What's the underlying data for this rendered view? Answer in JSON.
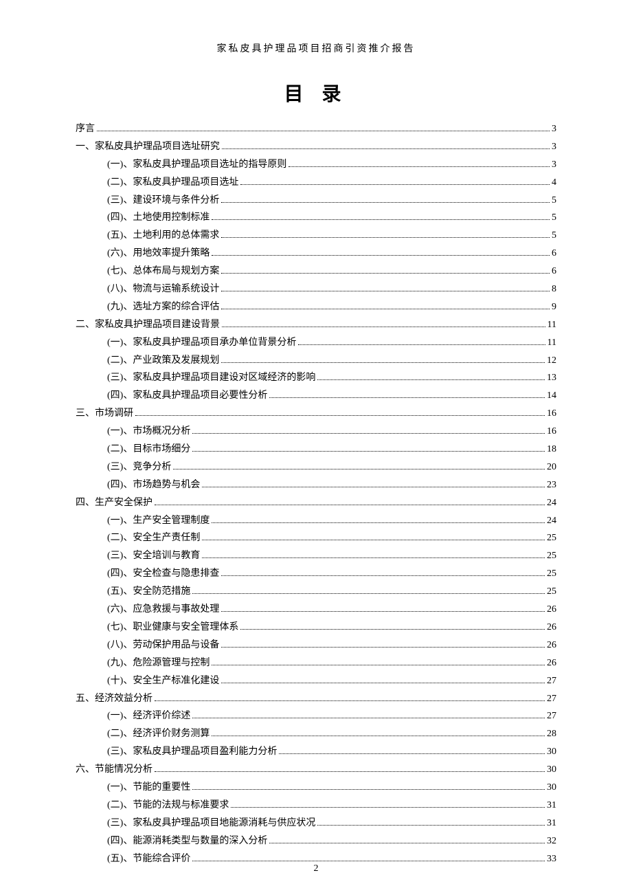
{
  "header": "家私皮具护理品项目招商引资推介报告",
  "toc_title": "目 录",
  "page_number": "2",
  "entries": [
    {
      "level": 0,
      "label": "序言",
      "page": "3"
    },
    {
      "level": 0,
      "label": "一、家私皮具护理品项目选址研究",
      "page": "3"
    },
    {
      "level": 1,
      "label": "(一)、家私皮具护理品项目选址的指导原则",
      "page": "3"
    },
    {
      "level": 1,
      "label": "(二)、家私皮具护理品项目选址",
      "page": "4"
    },
    {
      "level": 1,
      "label": "(三)、建设环境与条件分析",
      "page": "5"
    },
    {
      "level": 1,
      "label": "(四)、土地使用控制标准",
      "page": "5"
    },
    {
      "level": 1,
      "label": "(五)、土地利用的总体需求",
      "page": "5"
    },
    {
      "level": 1,
      "label": "(六)、用地效率提升策略",
      "page": "6"
    },
    {
      "level": 1,
      "label": "(七)、总体布局与规划方案",
      "page": "6"
    },
    {
      "level": 1,
      "label": "(八)、物流与运输系统设计",
      "page": "8"
    },
    {
      "level": 1,
      "label": "(九)、选址方案的综合评估",
      "page": "9"
    },
    {
      "level": 0,
      "label": "二、家私皮具护理品项目建设背景",
      "page": "11"
    },
    {
      "level": 1,
      "label": "(一)、家私皮具护理品项目承办单位背景分析",
      "page": "11"
    },
    {
      "level": 1,
      "label": "(二)、产业政策及发展规划",
      "page": "12"
    },
    {
      "level": 1,
      "label": "(三)、家私皮具护理品项目建设对区域经济的影响",
      "page": "13"
    },
    {
      "level": 1,
      "label": "(四)、家私皮具护理品项目必要性分析",
      "page": "14"
    },
    {
      "level": 0,
      "label": "三、市场调研",
      "page": "16"
    },
    {
      "level": 1,
      "label": "(一)、市场概况分析",
      "page": "16"
    },
    {
      "level": 1,
      "label": "(二)、目标市场细分",
      "page": "18"
    },
    {
      "level": 1,
      "label": "(三)、竞争分析",
      "page": "20"
    },
    {
      "level": 1,
      "label": "(四)、市场趋势与机会",
      "page": "23"
    },
    {
      "level": 0,
      "label": "四、生产安全保护",
      "page": "24"
    },
    {
      "level": 1,
      "label": "(一)、生产安全管理制度",
      "page": "24"
    },
    {
      "level": 1,
      "label": "(二)、安全生产责任制",
      "page": "25"
    },
    {
      "level": 1,
      "label": "(三)、安全培训与教育",
      "page": "25"
    },
    {
      "level": 1,
      "label": "(四)、安全检查与隐患排查",
      "page": "25"
    },
    {
      "level": 1,
      "label": "(五)、安全防范措施",
      "page": "25"
    },
    {
      "level": 1,
      "label": "(六)、应急救援与事故处理",
      "page": "26"
    },
    {
      "level": 1,
      "label": "(七)、职业健康与安全管理体系",
      "page": "26"
    },
    {
      "level": 1,
      "label": "(八)、劳动保护用品与设备",
      "page": "26"
    },
    {
      "level": 1,
      "label": "(九)、危险源管理与控制",
      "page": "26"
    },
    {
      "level": 1,
      "label": "(十)、安全生产标准化建设",
      "page": "27"
    },
    {
      "level": 0,
      "label": "五、经济效益分析",
      "page": "27"
    },
    {
      "level": 1,
      "label": "(一)、经济评价综述",
      "page": "27"
    },
    {
      "level": 1,
      "label": "(二)、经济评价财务测算",
      "page": "28"
    },
    {
      "level": 1,
      "label": "(三)、家私皮具护理品项目盈利能力分析",
      "page": "30"
    },
    {
      "level": 0,
      "label": "六、节能情况分析",
      "page": "30"
    },
    {
      "level": 1,
      "label": "(一)、节能的重要性",
      "page": "30"
    },
    {
      "level": 1,
      "label": "(二)、节能的法规与标准要求",
      "page": "31"
    },
    {
      "level": 1,
      "label": "(三)、家私皮具护理品项目地能源消耗与供应状况",
      "page": "31"
    },
    {
      "level": 1,
      "label": "(四)、能源消耗类型与数量的深入分析",
      "page": "32"
    },
    {
      "level": 1,
      "label": "(五)、节能综合评价",
      "page": "33"
    }
  ]
}
